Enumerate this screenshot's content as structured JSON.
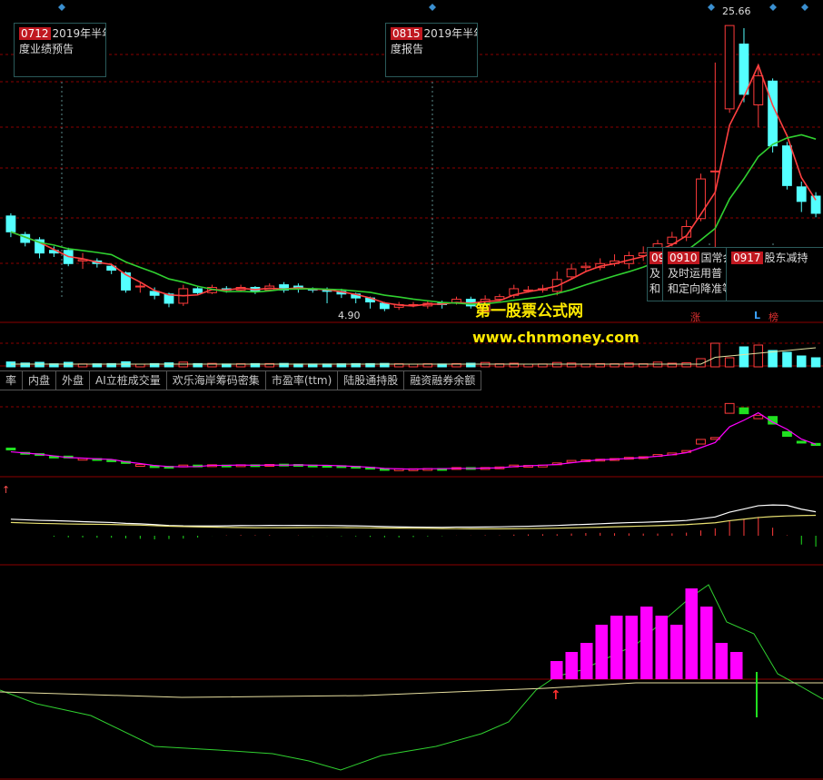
{
  "tabs": [
    "率",
    "内盘",
    "外盘",
    "AI立桩成交量",
    "欢乐海岸筹码密集",
    "市盈率(ttm)",
    "陆股通持股",
    "融资融券余额"
  ],
  "events": [
    {
      "date": "0712",
      "text": "2019年半年度业绩预告",
      "line1": "2019年半年",
      "line2": "度业绩预告"
    },
    {
      "date": "0815",
      "text": "2019年半年度报告",
      "line1": "2019年半年",
      "line2": "度报告"
    },
    {
      "date": "0910",
      "line1": "国常会",
      "line2": "及时运用普",
      "line3": "和定向降准等"
    },
    {
      "date": "0917",
      "line1": "股东减持"
    }
  ],
  "partial_event": {
    "date": "09",
    "line2": "及",
    "line3": "和"
  },
  "price_labels": {
    "high": "25.66",
    "low": "4.90"
  },
  "badges": {
    "zhang": "涨",
    "l": "L",
    "bang": "榜"
  },
  "watermark": {
    "name": "第一股票公式网",
    "url": "www.chnmoney.com"
  },
  "colors": {
    "up": "#ff3b3b",
    "down": "#54ffff",
    "ma_short": "#ff4040",
    "ma_long": "#30d030",
    "grid": "#8b0000",
    "event_border": "#2a5a5a",
    "magenta": "#ff00ff",
    "yellow_text": "#ffea00"
  },
  "chart_data": {
    "type": "candlestick",
    "price_range": [
      3.5,
      26.5
    ],
    "candles": [
      {
        "o": 11.2,
        "c": 10.0,
        "h": 11.4,
        "l": 9.6
      },
      {
        "o": 9.8,
        "c": 9.2,
        "h": 10.0,
        "l": 8.9
      },
      {
        "o": 9.4,
        "c": 8.4,
        "h": 9.6,
        "l": 8.0
      },
      {
        "o": 8.6,
        "c": 8.4,
        "h": 8.9,
        "l": 8.1
      },
      {
        "o": 8.6,
        "c": 7.6,
        "h": 8.8,
        "l": 7.4
      },
      {
        "o": 7.8,
        "c": 7.9,
        "h": 8.4,
        "l": 7.2
      },
      {
        "o": 7.8,
        "c": 7.6,
        "h": 8.0,
        "l": 7.3
      },
      {
        "o": 7.4,
        "c": 7.1,
        "h": 7.6,
        "l": 6.8
      },
      {
        "o": 6.9,
        "c": 5.6,
        "h": 7.0,
        "l": 5.4
      },
      {
        "o": 5.9,
        "c": 5.9,
        "h": 6.2,
        "l": 5.4
      },
      {
        "o": 5.5,
        "c": 5.2,
        "h": 5.8,
        "l": 4.9
      },
      {
        "o": 5.3,
        "c": 4.6,
        "h": 5.4,
        "l": 4.3
      },
      {
        "o": 4.6,
        "c": 5.7,
        "h": 6.0,
        "l": 4.4
      },
      {
        "o": 5.7,
        "c": 5.4,
        "h": 5.9,
        "l": 5.2
      },
      {
        "o": 5.4,
        "c": 5.8,
        "h": 6.0,
        "l": 5.3
      },
      {
        "o": 5.7,
        "c": 5.6,
        "h": 5.9,
        "l": 5.4
      },
      {
        "o": 5.6,
        "c": 5.8,
        "h": 6.0,
        "l": 5.5
      },
      {
        "o": 5.8,
        "c": 5.5,
        "h": 5.9,
        "l": 5.3
      },
      {
        "o": 5.6,
        "c": 5.9,
        "h": 6.1,
        "l": 5.5
      },
      {
        "o": 6.0,
        "c": 5.6,
        "h": 6.2,
        "l": 5.4
      },
      {
        "o": 5.9,
        "c": 5.8,
        "h": 6.1,
        "l": 5.4
      },
      {
        "o": 5.7,
        "c": 5.6,
        "h": 5.8,
        "l": 5.4
      },
      {
        "o": 5.6,
        "c": 5.5,
        "h": 5.8,
        "l": 4.6
      },
      {
        "o": 5.5,
        "c": 5.3,
        "h": 5.7,
        "l": 5.0
      },
      {
        "o": 5.3,
        "c": 5.0,
        "h": 5.4,
        "l": 4.6
      },
      {
        "o": 5.0,
        "c": 4.7,
        "h": 5.1,
        "l": 4.2
      },
      {
        "o": 4.6,
        "c": 4.2,
        "h": 4.7,
        "l": 4.0
      },
      {
        "o": 4.3,
        "c": 4.5,
        "h": 4.7,
        "l": 4.1
      },
      {
        "o": 4.5,
        "c": 4.5,
        "h": 4.7,
        "l": 4.3
      },
      {
        "o": 4.4,
        "c": 4.6,
        "h": 4.8,
        "l": 4.2
      },
      {
        "o": 4.6,
        "c": 4.5,
        "h": 4.8,
        "l": 4.2
      },
      {
        "o": 4.6,
        "c": 4.9,
        "h": 5.1,
        "l": 4.5
      },
      {
        "o": 4.9,
        "c": 4.4,
        "h": 5.1,
        "l": 4.2
      },
      {
        "o": 4.0,
        "c": 4.9,
        "h": 5.2,
        "l": 3.9
      },
      {
        "o": 4.9,
        "c": 5.1,
        "h": 5.3,
        "l": 4.8
      },
      {
        "o": 5.2,
        "c": 5.7,
        "h": 6.0,
        "l": 5.0
      },
      {
        "o": 5.6,
        "c": 5.6,
        "h": 5.9,
        "l": 5.4
      },
      {
        "o": 5.6,
        "c": 5.7,
        "h": 6.0,
        "l": 5.4
      },
      {
        "o": 5.5,
        "c": 6.4,
        "h": 7.0,
        "l": 5.2
      },
      {
        "o": 6.6,
        "c": 7.2,
        "h": 7.6,
        "l": 6.4
      },
      {
        "o": 7.3,
        "c": 7.4,
        "h": 7.7,
        "l": 7.0
      },
      {
        "o": 7.3,
        "c": 7.6,
        "h": 8.0,
        "l": 7.1
      },
      {
        "o": 7.6,
        "c": 7.8,
        "h": 8.3,
        "l": 7.4
      },
      {
        "o": 7.6,
        "c": 8.2,
        "h": 8.5,
        "l": 7.2
      },
      {
        "o": 8.2,
        "c": 8.4,
        "h": 8.9,
        "l": 7.8
      },
      {
        "o": 8.0,
        "c": 9.1,
        "h": 9.4,
        "l": 7.9
      },
      {
        "o": 9.1,
        "c": 9.6,
        "h": 10.0,
        "l": 8.9
      },
      {
        "o": 9.6,
        "c": 10.4,
        "h": 10.9,
        "l": 9.3
      },
      {
        "o": 11.0,
        "c": 14.0,
        "h": 14.4,
        "l": 10.8
      },
      {
        "o": 14.6,
        "c": 14.6,
        "h": 22.8,
        "l": 7.5
      },
      {
        "o": 19.3,
        "c": 25.6,
        "h": 25.6,
        "l": 19.0
      },
      {
        "o": 24.2,
        "c": 20.4,
        "h": 25.4,
        "l": 19.8
      },
      {
        "o": 19.6,
        "c": 21.8,
        "h": 22.6,
        "l": 17.9
      },
      {
        "o": 21.4,
        "c": 16.5,
        "h": 21.6,
        "l": 16.0
      },
      {
        "o": 16.5,
        "c": 13.5,
        "h": 16.8,
        "l": 13.2
      },
      {
        "o": 13.4,
        "c": 12.3,
        "h": 13.8,
        "l": 11.5
      },
      {
        "o": 12.7,
        "c": 11.4,
        "h": 13.0,
        "l": 11.1
      }
    ],
    "indicator_bars": [
      0.2,
      0.3,
      0.4,
      0.6,
      0.7,
      0.7,
      0.8,
      0.7,
      0.6,
      1.0,
      0.8,
      0.4,
      0.3
    ]
  }
}
